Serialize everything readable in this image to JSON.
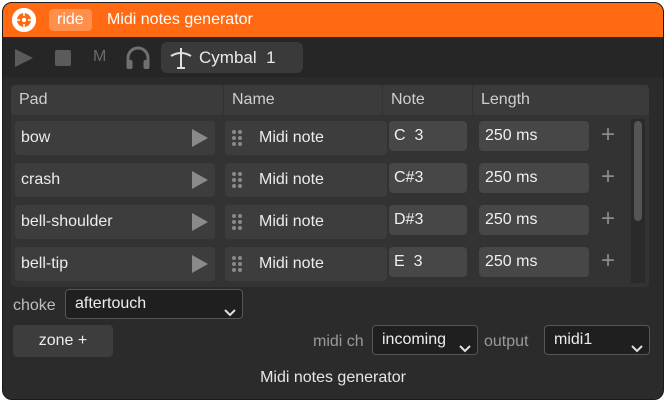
{
  "titlebar": {
    "tag": "ride",
    "title": "Midi notes generator"
  },
  "toolbar": {
    "m_label": "M",
    "instrument": "Cymbal  1"
  },
  "table": {
    "headers": [
      "Pad",
      "Name",
      "Note",
      "Length"
    ],
    "rows": [
      {
        "pad": "bow",
        "name": "Midi note",
        "note": "C  3",
        "length": "250 ms"
      },
      {
        "pad": "crash",
        "name": "Midi note",
        "note": "C#3",
        "length": "250 ms"
      },
      {
        "pad": "bell-shoulder",
        "name": "Midi note",
        "note": "D#3",
        "length": "250 ms"
      },
      {
        "pad": "bell-tip",
        "name": "Midi note",
        "note": "E  3",
        "length": "250 ms"
      }
    ],
    "add_symbol": "+"
  },
  "choke": {
    "label": "choke",
    "value": "aftertouch"
  },
  "zone_button": "zone +",
  "midi_ch": {
    "label": "midi ch",
    "value": "incoming"
  },
  "output": {
    "label": "output",
    "value": "midi1"
  },
  "footer": "Midi notes generator",
  "colors": {
    "accent": "#ff6a13",
    "panel": "#2b2b2b",
    "cell": "#3d3d3d"
  }
}
